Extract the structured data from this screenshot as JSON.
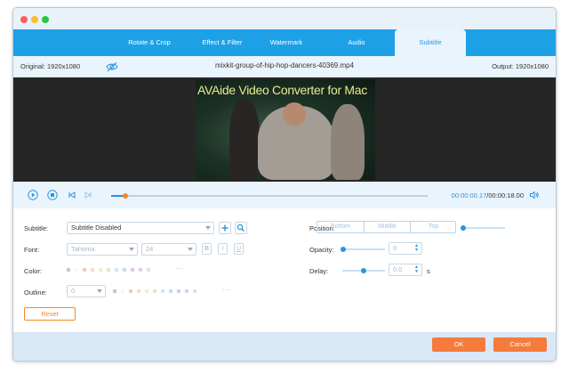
{
  "window": {
    "traffic_lights": [
      "close",
      "minimize",
      "zoom"
    ]
  },
  "tabs": [
    {
      "label": "Rotate & Crop"
    },
    {
      "label": "Effect & Filter"
    },
    {
      "label": "Watermark"
    },
    {
      "label": "Audio"
    },
    {
      "label": "Subtitle",
      "active": true
    }
  ],
  "info": {
    "original": "Original: 1920x1080",
    "filename": "mixkit-group-of-hip-hop-dancers-40369.mp4",
    "output": "Output: 1920x1080",
    "eye_icon": "eye-slash-icon"
  },
  "preview": {
    "watermark_text": "AVAide Video Converter for Mac"
  },
  "playback": {
    "current_time": "00:00:00.17",
    "total_time": "/00:00:18.00",
    "progress": 0.045,
    "icons": [
      "play-icon",
      "stop-icon",
      "previous-icon",
      "next-icon",
      "volume-icon"
    ]
  },
  "subtitle_panel": {
    "subtitle_label": "Subtitle:",
    "subtitle_value": "Subtitle Disabled",
    "font_label": "Font:",
    "font_value": "Tahoma",
    "font_size": "24",
    "bold": "B",
    "italic": "I",
    "underline": "U",
    "color_label": "Color:",
    "outline_label": "Outline:",
    "outline_value": "0",
    "position_label": "Position:",
    "position_options": [
      "Bottom",
      "Middle",
      "Top"
    ],
    "opacity_label": "Opacity:",
    "opacity_value": "0",
    "delay_label": "Delay:",
    "delay_value": "0.0",
    "delay_unit": "s",
    "reset_label": "Reset",
    "more": "···"
  },
  "footer": {
    "ok_label": "OK",
    "cancel_label": "Cancel"
  },
  "colors": {
    "accent": "#1ea0e7",
    "orange": "#f47b3b",
    "swatches": [
      "#c9c9c9",
      "#f7f7f7",
      "#f2c6c6",
      "#f7ddc4",
      "#f4f0c4",
      "#d3eed0",
      "#c7ebee",
      "#c9daf3",
      "#d5ccee",
      "#ecc7e5",
      "#e0e0e0"
    ]
  }
}
